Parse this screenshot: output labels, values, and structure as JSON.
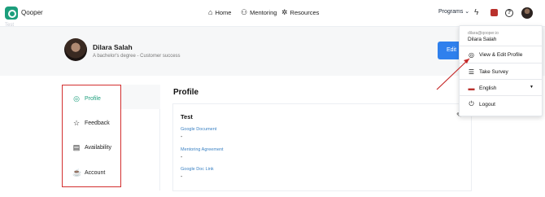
{
  "header": {
    "brand": "Qooper",
    "nav": [
      {
        "label": "Home",
        "icon": "home-icon"
      },
      {
        "label": "Mentoring",
        "icon": "mentoring-icon"
      },
      {
        "label": "Resources",
        "icon": "resources-icon"
      }
    ],
    "programs_label": "Programs"
  },
  "faint_text": "Test",
  "profile": {
    "name": "Dilara Salah",
    "subtitle": "A bachelor's degree - Customer success",
    "edit_label": "Edit"
  },
  "sidebar": {
    "items": [
      {
        "label": "Profile",
        "icon": "person-icon",
        "active": true
      },
      {
        "label": "Feedback",
        "icon": "star-icon",
        "active": false
      },
      {
        "label": "Availability",
        "icon": "calendar-icon",
        "active": false
      },
      {
        "label": "Account",
        "icon": "account-icon",
        "active": false
      }
    ]
  },
  "main": {
    "title": "Profile",
    "section_title": "Test",
    "fields": [
      {
        "label": "Google Document",
        "value": "-"
      },
      {
        "label": "Mentoring Agreement",
        "value": "-"
      },
      {
        "label": "Google Doc Link",
        "value": "-"
      }
    ]
  },
  "dropdown": {
    "email": "dilara@qooper.io",
    "name": "Dilara Salah",
    "items": [
      {
        "label": "View & Edit Profile",
        "icon": "person-icon"
      },
      {
        "label": "Take Survey",
        "icon": "list-icon"
      },
      {
        "label": "English",
        "icon": "flag-icon"
      },
      {
        "label": "Logout",
        "icon": "power-icon"
      }
    ]
  },
  "colors": {
    "brand": "#1c9e7c",
    "accent": "#2f80ed",
    "highlight_border": "#d32f2f",
    "link": "#3b82c4"
  }
}
